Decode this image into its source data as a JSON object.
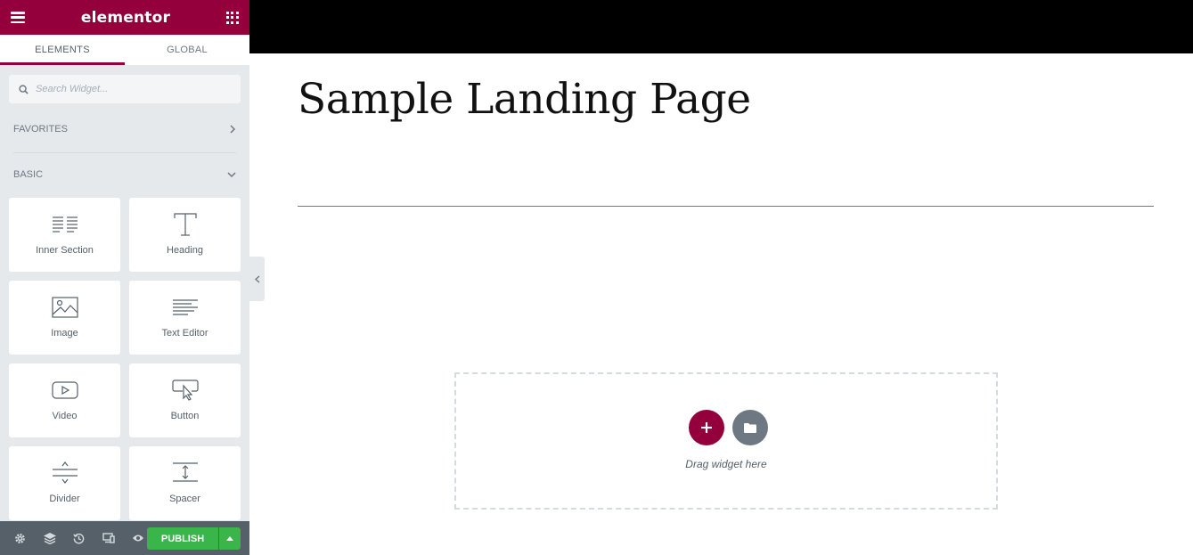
{
  "app": {
    "brand": "elementor"
  },
  "tabs": [
    {
      "label": "ELEMENTS",
      "active": true
    },
    {
      "label": "GLOBAL",
      "active": false
    }
  ],
  "search": {
    "placeholder": "Search Widget..."
  },
  "categories": {
    "favorites": "FAVORITES",
    "basic": "BASIC"
  },
  "widgets": [
    {
      "label": "Inner Section",
      "icon": "inner-section-icon"
    },
    {
      "label": "Heading",
      "icon": "heading-icon"
    },
    {
      "label": "Image",
      "icon": "image-icon"
    },
    {
      "label": "Text Editor",
      "icon": "text-editor-icon"
    },
    {
      "label": "Video",
      "icon": "video-icon"
    },
    {
      "label": "Button",
      "icon": "button-icon"
    },
    {
      "label": "Divider",
      "icon": "divider-icon"
    },
    {
      "label": "Spacer",
      "icon": "spacer-icon"
    }
  ],
  "footer": {
    "publish_label": "PUBLISH"
  },
  "canvas": {
    "title": "Sample Landing Page",
    "drag_text": "Drag widget here"
  },
  "colors": {
    "brand": "#93003c",
    "publish": "#39b54a",
    "panel": "#e6e9ec",
    "footer": "#556068"
  }
}
